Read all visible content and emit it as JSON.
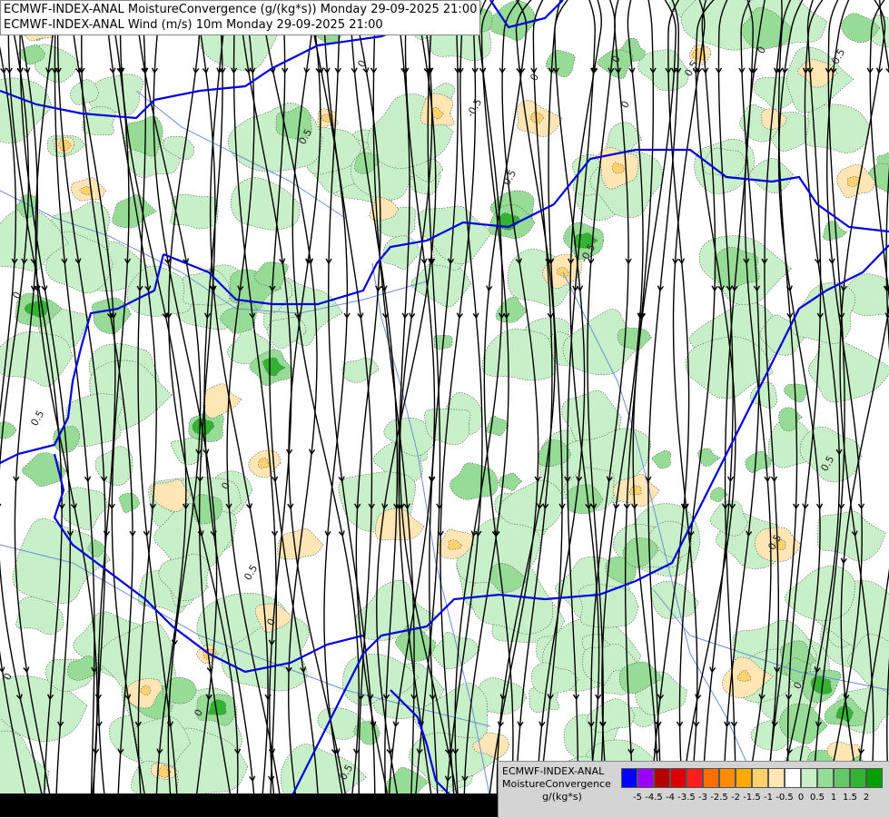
{
  "titles": {
    "line1": "ECMWF-INDEX-ANAL MoistureConvergence (g/(kg*s)) Monday 29-09-2025 21:00",
    "line2": "ECMWF-INDEX-ANAL Wind (m/s) 10m Monday 29-09-2025 21:00"
  },
  "legend": {
    "title_line1": "ECMWF-INDEX-ANAL",
    "title_line2": "MoistureConvergence",
    "unit": "g/(kg*s)",
    "colors": [
      "#0000ff",
      "#9b00ff",
      "#b40000",
      "#dc0000",
      "#ff1e1e",
      "#ff6e00",
      "#ff8c00",
      "#ffaa00",
      "#ffd26e",
      "#ffe6b4",
      "#ffffff",
      "#c8f0c8",
      "#96dc96",
      "#64c864",
      "#32b432",
      "#00a000"
    ],
    "tick_labels": [
      "-5",
      "-4.5",
      "-4",
      "-3.5",
      "-3",
      "-2.5",
      "-2",
      "-1.5",
      "-1",
      "-0.5",
      "0",
      "0.5",
      "1",
      "1.5",
      "2"
    ]
  },
  "contour_labels": [
    "0",
    "0.5",
    "-0.5",
    "0.5",
    "0",
    "0.5",
    "0",
    "-0.5",
    "0",
    "0.5",
    "0",
    "0.5",
    "0",
    "-0.5",
    "0",
    "0.5",
    "0",
    "-0.5",
    "0",
    "0.5",
    "0",
    "0"
  ],
  "colors": {
    "border": "#0000dd",
    "river": "#6a8fd6",
    "streamline": "#000000",
    "green_light": "#c8f0c8",
    "green_mid": "#96dc96",
    "green_dark": "#32b432",
    "orange_light": "#ffe6b4",
    "orange_mid": "#ffd26e",
    "orange_dark": "#ffaa00"
  }
}
